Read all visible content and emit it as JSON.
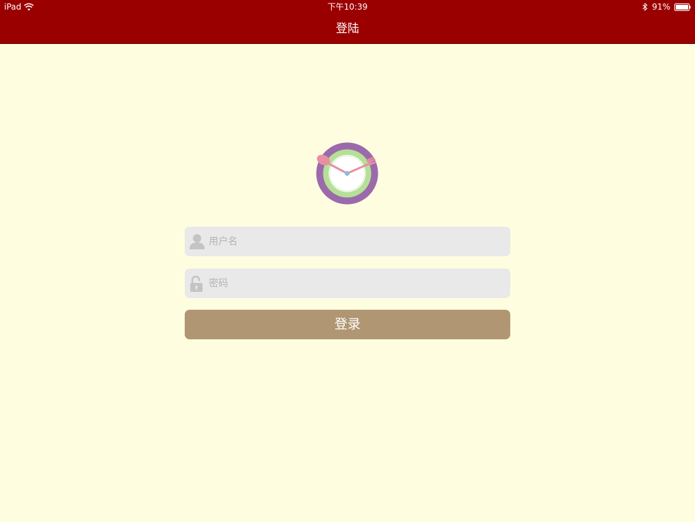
{
  "status_bar": {
    "device": "iPad",
    "time": "下午10:39",
    "battery": "91%",
    "icons": [
      "wifi-icon",
      "bluetooth-icon",
      "battery-icon"
    ]
  },
  "nav": {
    "title": "登陆"
  },
  "logo": {
    "icon": "clock-with-spoon-and-fork-logo"
  },
  "form": {
    "username": {
      "placeholder": "用户名",
      "value": "",
      "icon": "user-icon"
    },
    "password": {
      "placeholder": "密码",
      "value": "",
      "icon": "unlock-icon"
    },
    "submit_label": "登录"
  },
  "colors": {
    "header": "#9b0000",
    "background": "#fffde0",
    "field": "#e9e9e9",
    "button": "#b09672",
    "logo_ring": "#9b6aaa",
    "logo_inner_ring": "#b6df98",
    "utensils": "#e88fa3"
  }
}
